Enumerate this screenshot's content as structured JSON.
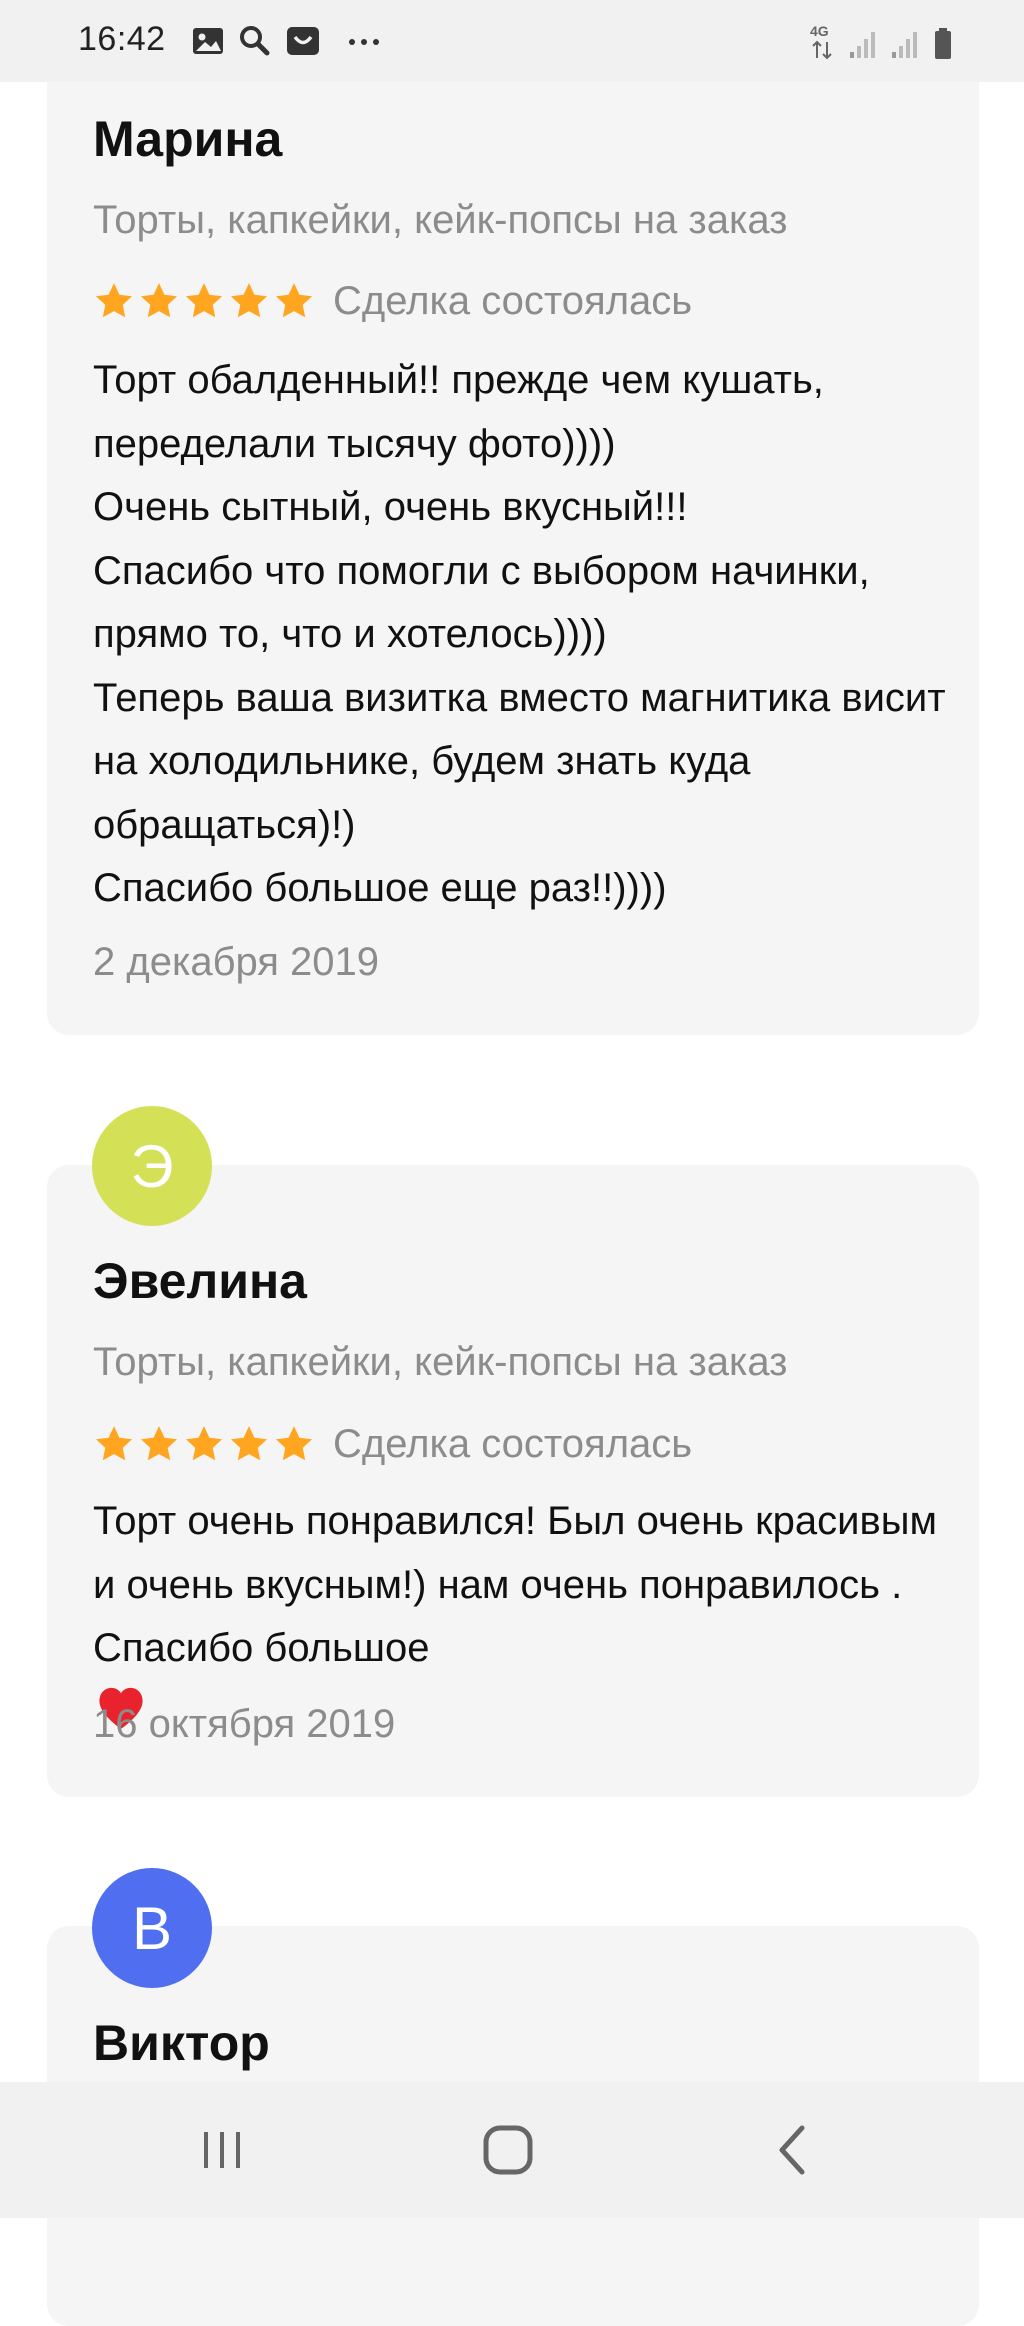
{
  "status_bar": {
    "time": "16:42",
    "network": "4G",
    "icons": [
      "image-icon",
      "search-icon",
      "bag-icon",
      "more-icon",
      "signal-icon",
      "battery-icon"
    ]
  },
  "reviews": [
    {
      "name": "Марина",
      "service": "Торты, капкейки, кейк-попсы на заказ",
      "stars": 5,
      "deal_status": "Сделка состоялась",
      "text": "Торт обалденный!! прежде чем кушать, переделали тысячу фото))))\nОчень сытный, очень вкусный!!!\nСпасибо что помогли с выбором начинки, прямо то, что и хотелось))))\nТеперь ваша  визитка вместо магнитика висит на холодильнике, будем знать куда обращаться)!)\nСпасибо большое еще раз!!))))",
      "date": "2 декабря 2019"
    },
    {
      "avatar_letter": "Э",
      "avatar_color": "#d4e157",
      "name": "Эвелина",
      "service": "Торты, капкейки, кейк-попсы на заказ",
      "stars": 5,
      "deal_status": "Сделка состоялась",
      "text": "Торт очень понравился! Был очень красивым и очень вкусным!) нам очень понравилось . Спасибо большое",
      "date": "16 октября 2019"
    },
    {
      "avatar_letter": "В",
      "avatar_color": "#4f6ff0",
      "name": "Виктор"
    }
  ],
  "colors": {
    "star": "#ffa51f",
    "card_bg": "#f5f5f5",
    "muted_text": "#8c8c8c"
  },
  "nav_bar": {
    "buttons": [
      "recent-apps-icon",
      "home-icon",
      "back-icon"
    ]
  }
}
